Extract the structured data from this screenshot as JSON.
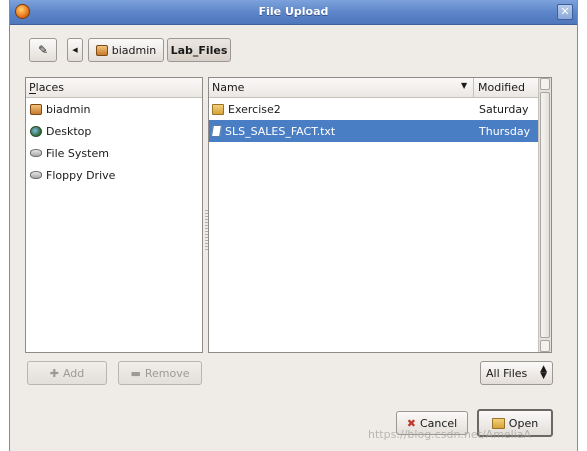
{
  "window": {
    "title": "File Upload"
  },
  "path_bar": {
    "buttons": [
      {
        "label": "biadmin",
        "icon": "home-folder-icon"
      },
      {
        "label": "Lab_Files"
      }
    ]
  },
  "places": {
    "header": "Places",
    "items": [
      {
        "label": "biadmin",
        "icon": "home-folder-icon"
      },
      {
        "label": "Desktop",
        "icon": "desktop-icon"
      },
      {
        "label": "File System",
        "icon": "hard-drive-icon"
      },
      {
        "label": "Floppy Drive",
        "icon": "floppy-drive-icon"
      }
    ]
  },
  "files": {
    "columns": {
      "name": "Name",
      "modified": "Modified"
    },
    "rows": [
      {
        "name": "Exercise2",
        "modified": "Saturday",
        "icon": "folder-icon",
        "selected": false
      },
      {
        "name": "SLS_SALES_FACT.txt",
        "modified": "Thursday",
        "icon": "text-file-icon",
        "selected": true
      }
    ]
  },
  "buttons": {
    "add": "Add",
    "remove": "Remove",
    "filter": "All Files",
    "cancel": "Cancel",
    "open": "Open"
  },
  "watermark": "https://blog.csdn.net/AmeliaA"
}
